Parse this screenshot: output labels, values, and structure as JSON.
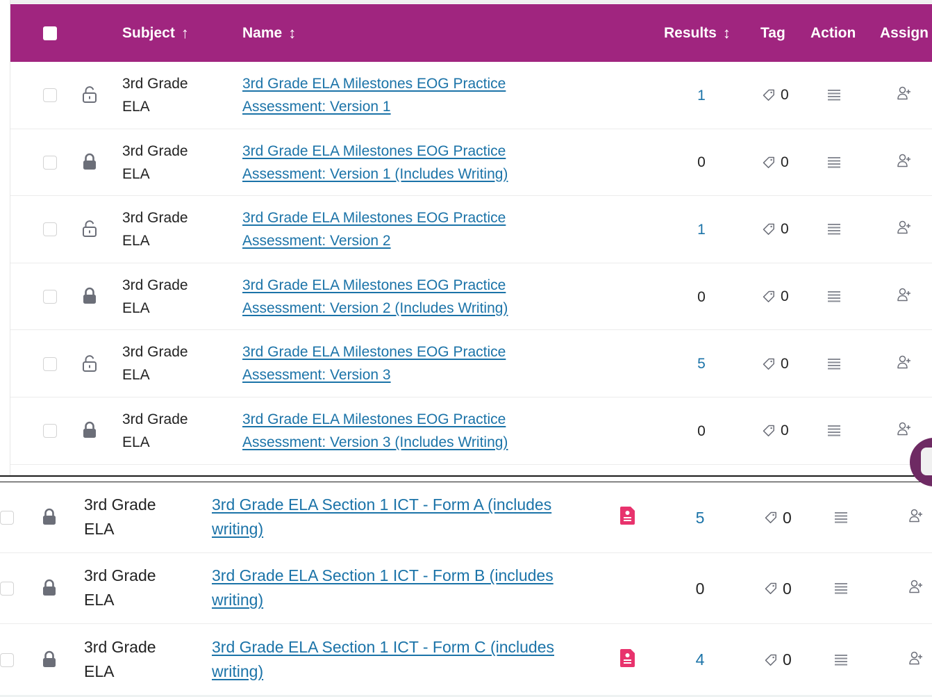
{
  "header": {
    "subject": "Subject",
    "subject_arrow": "↑",
    "name": "Name",
    "name_arrow": "↕",
    "results": "Results",
    "results_arrow": "↕",
    "tag": "Tag",
    "action": "Action",
    "assign": "Assign"
  },
  "top_rows": [
    {
      "subject1": "3rd Grade",
      "subject2": "ELA",
      "name1": "3rd Grade ELA Milestones EOG Practice",
      "name2": "Assessment: Version 1",
      "locked": false,
      "results": "1",
      "tag_count": "0"
    },
    {
      "subject1": "3rd Grade",
      "subject2": "ELA",
      "name1": "3rd Grade ELA Milestones EOG Practice",
      "name2": "Assessment: Version 1 (Includes Writing)",
      "locked": true,
      "results": "0",
      "tag_count": "0"
    },
    {
      "subject1": "3rd Grade",
      "subject2": "ELA",
      "name1": "3rd Grade ELA Milestones EOG Practice",
      "name2": "Assessment: Version 2",
      "locked": false,
      "results": "1",
      "tag_count": "0"
    },
    {
      "subject1": "3rd Grade",
      "subject2": "ELA",
      "name1": "3rd Grade ELA Milestones EOG Practice",
      "name2": "Assessment: Version 2 (Includes Writing)",
      "locked": true,
      "results": "0",
      "tag_count": "0"
    },
    {
      "subject1": "3rd Grade",
      "subject2": "ELA",
      "name1": "3rd Grade ELA Milestones EOG Practice",
      "name2": "Assessment: Version 3",
      "locked": false,
      "results": "5",
      "tag_count": "0"
    },
    {
      "subject1": "3rd Grade",
      "subject2": "ELA",
      "name1": "3rd Grade ELA Milestones EOG Practice",
      "name2": "Assessment: Version 3 (Includes Writing)",
      "locked": true,
      "results": "0",
      "tag_count": "0"
    }
  ],
  "bottom_rows": [
    {
      "subject1": "3rd Grade",
      "subject2": "ELA",
      "name1": "3rd Grade ELA Section 1 ICT - Form A (includes",
      "name2": "writing)",
      "locked": true,
      "doc_badge": true,
      "results": "5",
      "tag_count": "0"
    },
    {
      "subject1": "3rd Grade",
      "subject2": "ELA",
      "name1": "3rd Grade ELA Section 1 ICT - Form B (includes",
      "name2": "writing)",
      "locked": true,
      "doc_badge": false,
      "results": "0",
      "tag_count": "0"
    },
    {
      "subject1": "3rd Grade",
      "subject2": "ELA",
      "name1": "3rd Grade ELA Section 1 ICT - Form C (includes",
      "name2": "writing)",
      "locked": true,
      "doc_badge": true,
      "results": "4",
      "tag_count": "0"
    }
  ],
  "colors": {
    "header_bg": "#a0257f",
    "link": "#1b73a8",
    "badge": "#e8336d",
    "icon_gray": "#6b6e78"
  },
  "icons": {
    "lock_open": "unlocked-padlock-icon",
    "lock_closed": "locked-padlock-icon",
    "tag": "tag-icon",
    "action": "hamburger-menu-icon",
    "assign": "add-user-icon",
    "badge": "document-badge-icon"
  }
}
